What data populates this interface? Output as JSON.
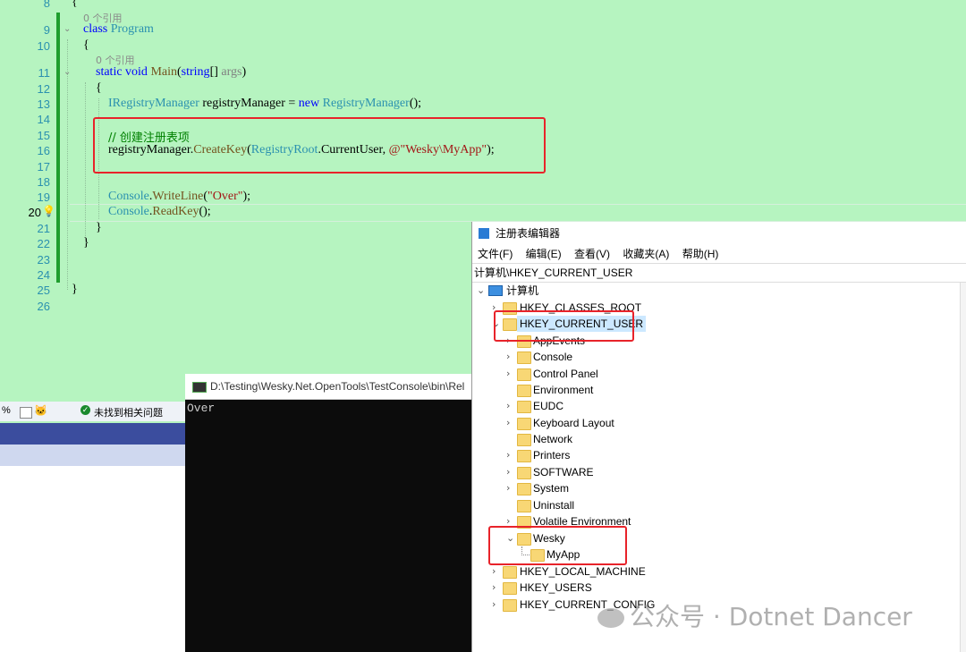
{
  "editor": {
    "ref_hint": "0 个引用",
    "lines": [
      {
        "n": "8",
        "code": "{"
      },
      {
        "n": "9",
        "code": "class Program"
      },
      {
        "n": "10",
        "code": "{"
      },
      {
        "n": "11",
        "code": "static void Main(string[] args)"
      },
      {
        "n": "12",
        "code": "{"
      },
      {
        "n": "13",
        "code": "IRegistryManager registryManager = new RegistryManager();"
      },
      {
        "n": "14",
        "code": ""
      },
      {
        "n": "15",
        "code": "// 创建注册表项"
      },
      {
        "n": "16",
        "code": "registryManager.CreateKey(RegistryRoot.CurrentUser, @\"Wesky\\MyApp\");"
      },
      {
        "n": "17",
        "code": ""
      },
      {
        "n": "18",
        "code": ""
      },
      {
        "n": "19",
        "code": "Console.WriteLine(\"Over\");"
      },
      {
        "n": "20",
        "code": "Console.ReadKey();"
      },
      {
        "n": "21",
        "code": "}"
      },
      {
        "n": "22",
        "code": "}"
      },
      {
        "n": "23",
        "code": ""
      },
      {
        "n": "24",
        "code": ""
      },
      {
        "n": "25",
        "code": "}"
      },
      {
        "n": "26",
        "code": ""
      }
    ]
  },
  "status": {
    "zoom": "%",
    "issues": "未找到相关问题"
  },
  "console": {
    "title": "D:\\Testing\\Wesky.Net.OpenTools\\TestConsole\\bin\\Rel",
    "output": "Over"
  },
  "regedit": {
    "title": "注册表编辑器",
    "menu": [
      "文件(F)",
      "编辑(E)",
      "查看(V)",
      "收藏夹(A)",
      "帮助(H)"
    ],
    "address": "计算机\\HKEY_CURRENT_USER",
    "root": "计算机",
    "top_keys": [
      "HKEY_CLASSES_ROOT",
      "HKEY_CURRENT_USER",
      "HKEY_LOCAL_MACHINE",
      "HKEY_USERS",
      "HKEY_CURRENT_CONFIG"
    ],
    "hkcu_children": [
      "AppEvents",
      "Console",
      "Control Panel",
      "Environment",
      "EUDC",
      "Keyboard Layout",
      "Network",
      "Printers",
      "SOFTWARE",
      "System",
      "Uninstall",
      "Volatile Environment",
      "Wesky"
    ],
    "wesky_child": "MyApp"
  },
  "watermark": "公众号 · Dotnet Dancer",
  "colors": {
    "editor_bg": "#b6f4c0",
    "highlight": "#e8232a",
    "selection": "#cce8ff"
  }
}
